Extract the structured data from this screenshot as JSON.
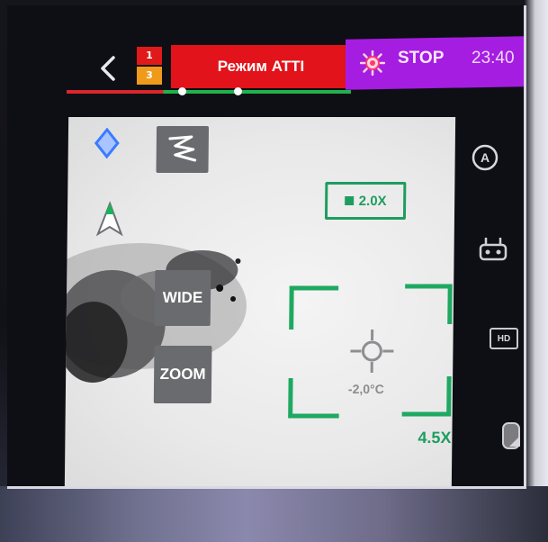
{
  "header": {
    "back_icon": "chevron-left-icon",
    "signal": {
      "top": "1",
      "bottom": "3"
    },
    "mode_label": "Режим ATTI",
    "stop_icon": "rotor-stop-icon",
    "stop_label": "STOP",
    "clock": "23:40"
  },
  "camera": {
    "mode_icon": "gesture-mode-icon",
    "wide_label": "WIDE",
    "zoom_label": "ZOOM",
    "zoom_indicator_label": "2.0X",
    "temperature": "-2,0°C",
    "zoom_factor": "4.5X"
  },
  "sidebar": {
    "camera_mode_icon": "camera-auto-icon",
    "controller_icon": "remote-controller-icon",
    "hd_label": "HD",
    "shutter_icon": "shutter-icon"
  },
  "colors": {
    "mode_banner": "#e2131b",
    "stop_panel": "#a51de0",
    "accent_green": "#1e9d5f",
    "diamond_blue": "#3a7bff"
  }
}
